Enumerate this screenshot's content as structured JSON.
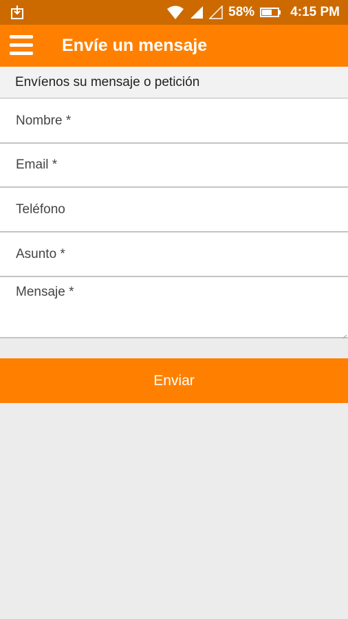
{
  "status_bar": {
    "battery": "58%",
    "time": "4:15 PM",
    "icons": [
      "download-icon",
      "wifi-icon",
      "signal-icon",
      "signal-empty-icon",
      "battery-icon"
    ]
  },
  "app_bar": {
    "title": "Envíe un mensaje",
    "menu_icon": "hamburger-menu-icon"
  },
  "form": {
    "subheader": "Envíenos su mensaje o petición",
    "fields": {
      "nombre": {
        "placeholder": "Nombre *",
        "value": ""
      },
      "email": {
        "placeholder": "Email *",
        "value": ""
      },
      "telefono": {
        "placeholder": "Teléfono",
        "value": ""
      },
      "asunto": {
        "placeholder": "Asunto *",
        "value": ""
      },
      "mensaje": {
        "placeholder": "Mensaje *",
        "value": ""
      }
    },
    "submit_label": "Enviar"
  },
  "colors": {
    "status_bar": "#cc6a00",
    "accent": "#ff8000",
    "background": "#ececec"
  }
}
